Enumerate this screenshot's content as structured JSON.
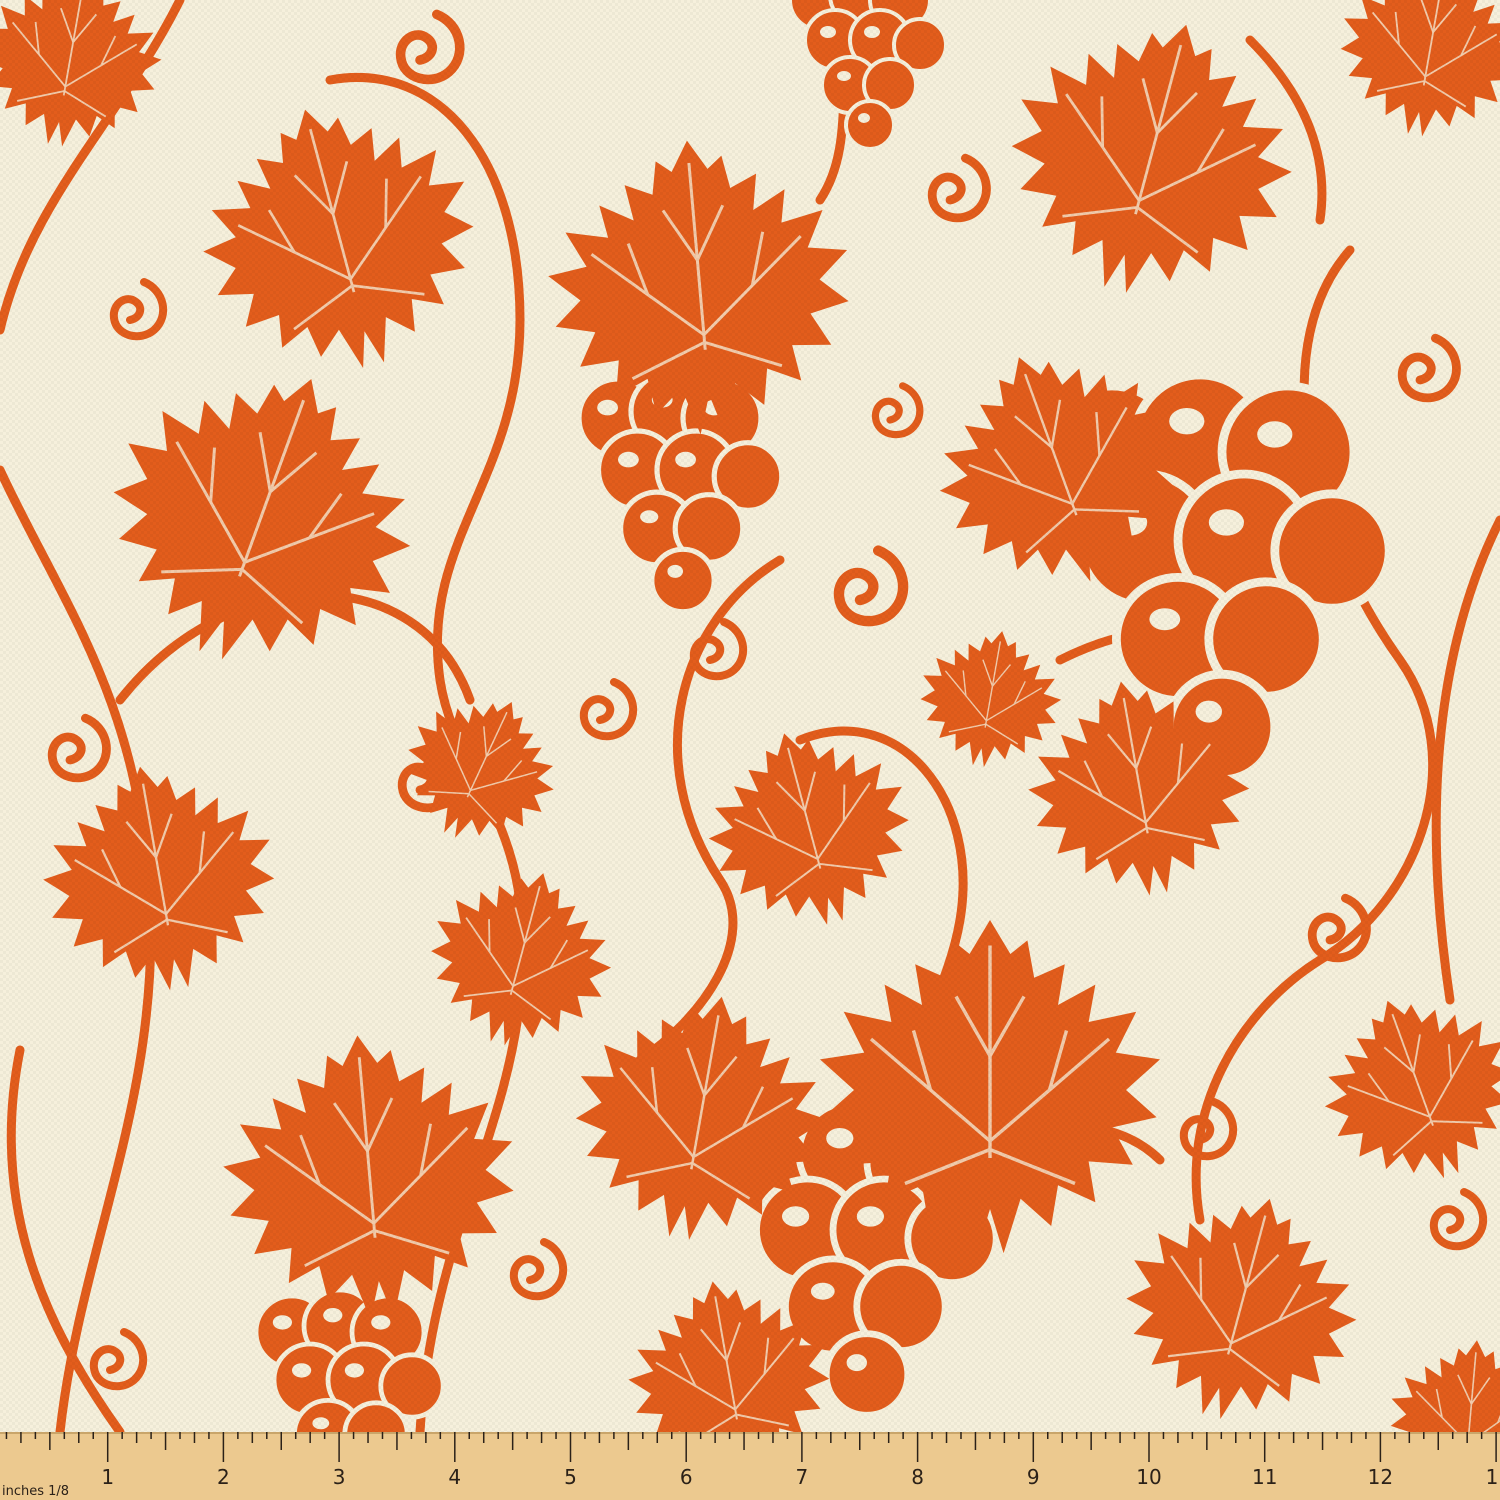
{
  "fabric": {
    "background_color": "#f6f0dc",
    "motif_color": "#e35d1c",
    "motifs": [
      "grape-leaf",
      "grape-cluster",
      "vine-tendril",
      "swirl"
    ]
  },
  "ruler": {
    "unit_label": "inches 1/8",
    "numbers": [
      "1",
      "2",
      "3",
      "4",
      "5",
      "6",
      "7",
      "8",
      "9",
      "10",
      "11",
      "12",
      "1"
    ],
    "wood_color": "#ecc98f",
    "tick_color": "#2b2118"
  }
}
